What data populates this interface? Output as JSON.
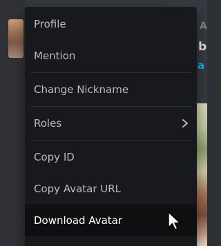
{
  "context_menu": {
    "items": [
      {
        "label": "Profile"
      },
      {
        "label": "Mention"
      },
      {
        "label": "Change Nickname"
      },
      {
        "label": "Roles"
      },
      {
        "label": "Copy ID"
      },
      {
        "label": "Copy Avatar URL"
      },
      {
        "label": "Download Avatar"
      }
    ],
    "active_item": "Download Avatar"
  },
  "chat": {
    "partial_header": "A",
    "partial_text": "b",
    "partial_link": "a"
  },
  "icons": {
    "submenu": "chevron-right-icon",
    "cursor": "mouse-pointer-icon"
  },
  "colors": {
    "menu_bg": "#18191c",
    "menu_text": "#b9bbbe",
    "active_bg": "#0e0f11",
    "active_text": "#ffffff",
    "link": "#00b0f4"
  }
}
